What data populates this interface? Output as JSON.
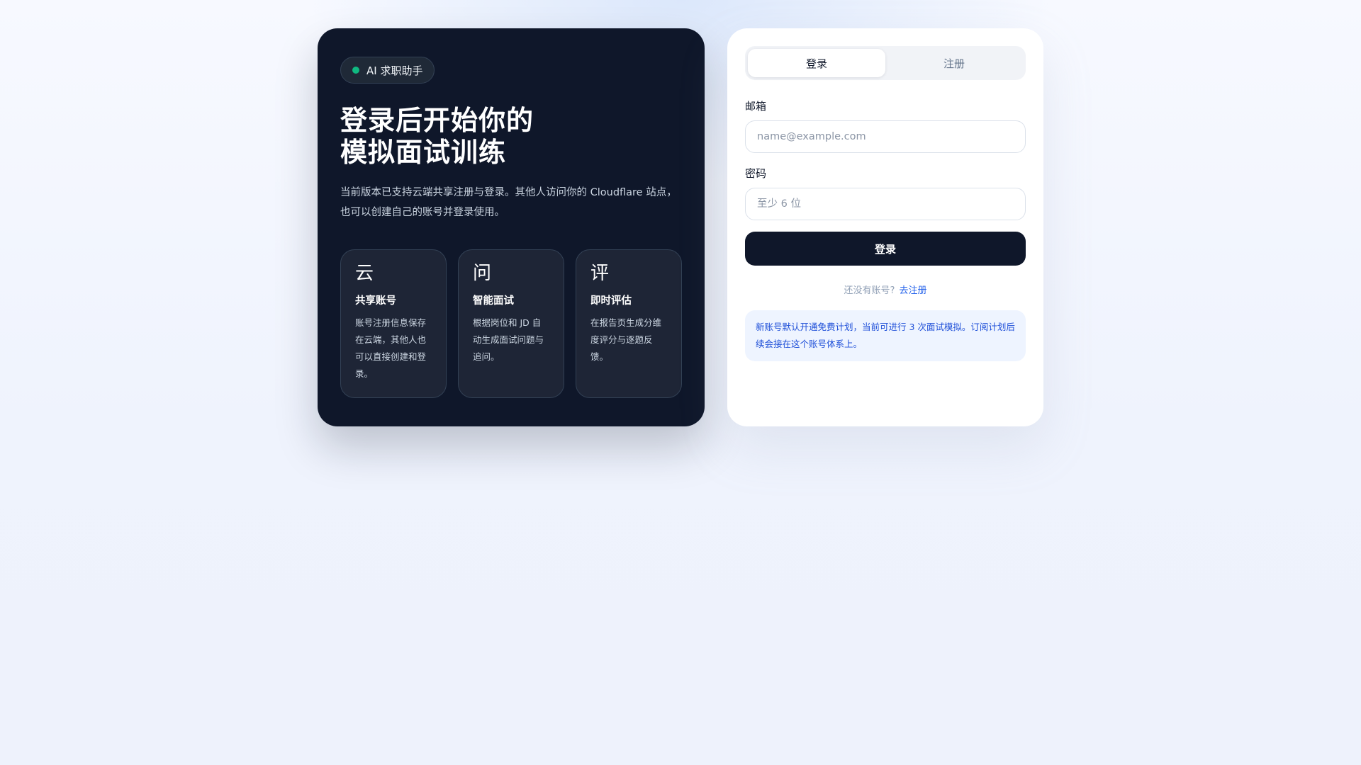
{
  "hero": {
    "badge": "AI 求职助手",
    "title_line1": "登录后开始你的",
    "title_line2": "模拟面试训练",
    "description": "当前版本已支持云端共享注册与登录。其他人访问你的 Cloudflare 站点，也可以创建自己的账号并登录使用。",
    "features": [
      {
        "icon": "云",
        "title": "共享账号",
        "desc": "账号注册信息保存在云端，其他人也可以直接创建和登录。"
      },
      {
        "icon": "问",
        "title": "智能面试",
        "desc": "根据岗位和 JD 自动生成面试问题与追问。"
      },
      {
        "icon": "评",
        "title": "即时评估",
        "desc": "在报告页生成分维度评分与逐题反馈。"
      }
    ]
  },
  "auth": {
    "tabs": {
      "login": "登录",
      "register": "注册"
    },
    "email_label": "邮箱",
    "email_placeholder": "name@example.com",
    "password_label": "密码",
    "password_placeholder": "至少 6 位",
    "submit_label": "登录",
    "switch_prompt": "还没有账号?",
    "switch_link": "去注册",
    "notice": "新账号默认开通免费计划，当前可进行 3 次面试模拟。订阅计划后续会接在这个账号体系上。"
  },
  "colors": {
    "accent_dark": "#0f172a",
    "status_dot": "#10b981",
    "link": "#2563eb",
    "notice_bg": "#eef4ff"
  }
}
